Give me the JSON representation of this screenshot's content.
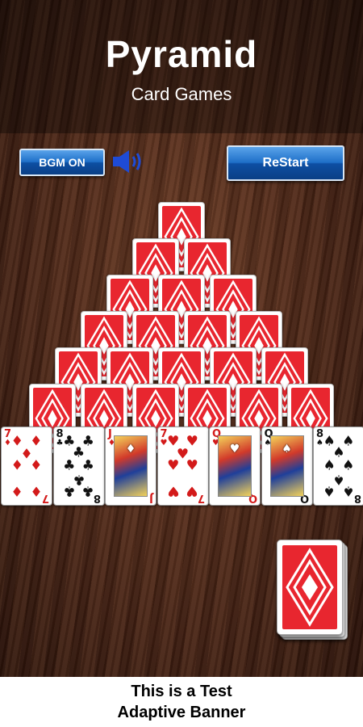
{
  "header": {
    "title": "Pyramid",
    "subtitle": "Card Games"
  },
  "controls": {
    "bgm_label": "BGM ON",
    "restart_label": "ReStart",
    "speaker_icon": "speaker-on-icon"
  },
  "pyramid": {
    "rows": [
      1,
      2,
      3,
      4,
      5,
      6
    ],
    "face_down": true,
    "back_color": "#e8262f"
  },
  "bottom_row": [
    {
      "rank": "7",
      "suit": "♦",
      "color": "red",
      "court": false
    },
    {
      "rank": "8",
      "suit": "♣",
      "color": "black",
      "court": false
    },
    {
      "rank": "J",
      "suit": "♦",
      "color": "red",
      "court": true
    },
    {
      "rank": "7",
      "suit": "♥",
      "color": "red",
      "court": false
    },
    {
      "rank": "Q",
      "suit": "♥",
      "color": "red",
      "court": true
    },
    {
      "rank": "Q",
      "suit": "♠",
      "color": "black",
      "court": true
    },
    {
      "rank": "8",
      "suit": "♠",
      "color": "black",
      "court": false
    }
  ],
  "stock": {
    "face_down": true
  },
  "banner": {
    "line1": "This is a Test",
    "line2": "Adaptive Banner"
  }
}
